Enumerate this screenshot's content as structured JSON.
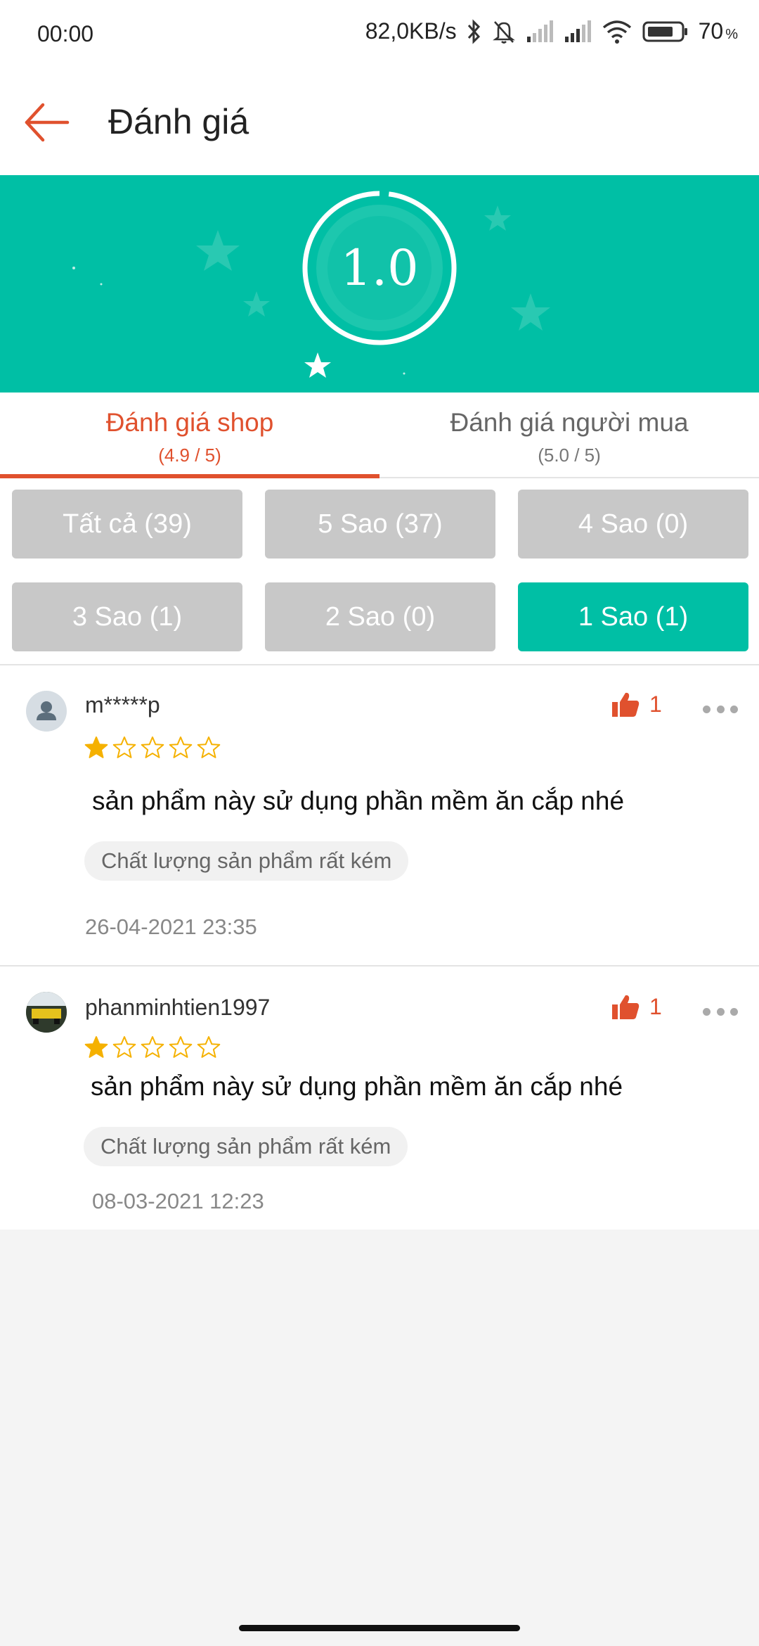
{
  "status_bar": {
    "time": "00:00",
    "network_speed": "82,0KB/s",
    "battery_level": "70",
    "battery_unit": "%",
    "icons": [
      "bluetooth-icon",
      "mute-icon",
      "signal-icon",
      "signal-icon",
      "wifi-icon",
      "battery-icon"
    ]
  },
  "header": {
    "back_icon": "arrow-left-icon",
    "title": "Đánh giá"
  },
  "rating": {
    "score": "1.0",
    "score_fraction": 0.98
  },
  "tabs": [
    {
      "label": "Đánh giá shop",
      "sub": "(4.9 / 5)",
      "active": true
    },
    {
      "label": "Đánh giá người mua",
      "sub": "(5.0 / 5)",
      "active": false
    }
  ],
  "filters": [
    {
      "label": "Tất cả (39)",
      "active": false
    },
    {
      "label": "5 Sao (37)",
      "active": false
    },
    {
      "label": "4 Sao (0)",
      "active": false
    },
    {
      "label": "3 Sao (1)",
      "active": false
    },
    {
      "label": "2 Sao (0)",
      "active": false
    },
    {
      "label": "1 Sao (1)",
      "active": true
    }
  ],
  "reviews": [
    {
      "username": "m*****p",
      "rating": 1,
      "max_rating": 5,
      "text": "sản phẩm này sử dụng phần mềm ăn cắp nhé",
      "tag": "Chất lượng sản phẩm rất kém",
      "date": "26-04-2021 23:35",
      "likes": "1",
      "avatar": "default-user-icon"
    },
    {
      "username": "phanminhtien1997",
      "rating": 1,
      "max_rating": 5,
      "text": "sản phẩm này sử dụng phần mềm ăn cắp nhé",
      "tag": "Chất lượng sản phẩm rất kém",
      "date": "08-03-2021 12:23",
      "likes": "1",
      "avatar": "photo-avatar"
    }
  ],
  "colors": {
    "accent": "#e0512e",
    "teal": "#00bfa5",
    "chip_inactive": "#c8c8c8",
    "star": "#f5b100"
  }
}
